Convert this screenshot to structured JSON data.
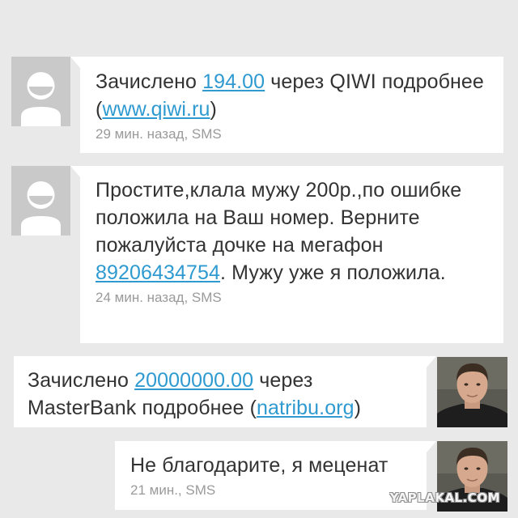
{
  "messages": [
    {
      "direction": "incoming",
      "text_before": "Зачислено ",
      "amount": "194.00",
      "text_middle": " через QIWI подробнее (",
      "link": "www.qiwi.ru",
      "text_after": ")",
      "meta": "29 мин. назад, SMS"
    },
    {
      "direction": "incoming",
      "text_before": "Простите,клала мужу 200р.,по ошибке положила на Ваш номер. Верните пожалуйста дочке на мегафон ",
      "phone": "89206434754",
      "text_after": ". Мужу уже я положила.",
      "meta": "24 мин. назад, SMS"
    },
    {
      "direction": "outgoing",
      "text_before": "Зачислено ",
      "amount": "20000000.00",
      "text_middle": " через MasterBank подробнее (",
      "link": "natribu.org",
      "text_after": ")"
    },
    {
      "direction": "outgoing",
      "text": "Не благодарите, я меценат",
      "meta": "21 мин., SMS"
    }
  ],
  "watermark": "YAPLAKAL.COM",
  "colors": {
    "background": "#e9e9e9",
    "bubble": "#ffffff",
    "link": "#2e9ad0",
    "meta": "#9a9a9a",
    "avatar_placeholder": "#c9c9c9"
  },
  "icons": {
    "contact_avatar": "default-person-icon",
    "sender_photo": "user-photo"
  }
}
